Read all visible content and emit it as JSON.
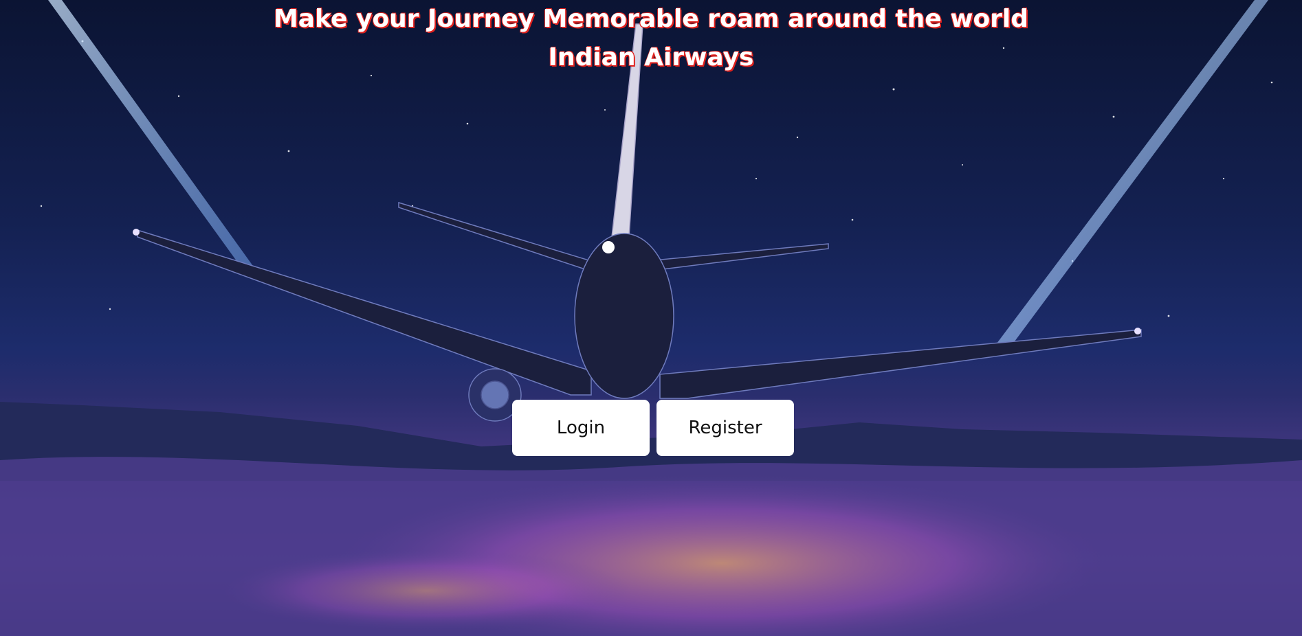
{
  "hero": {
    "line1": "Make your Journey Memorable roam around the world",
    "line2": "Indian Airways"
  },
  "actions": {
    "login_label": "Login",
    "register_label": "Register"
  },
  "background": {
    "description_icon": "airplane-night-sky-illustration"
  }
}
